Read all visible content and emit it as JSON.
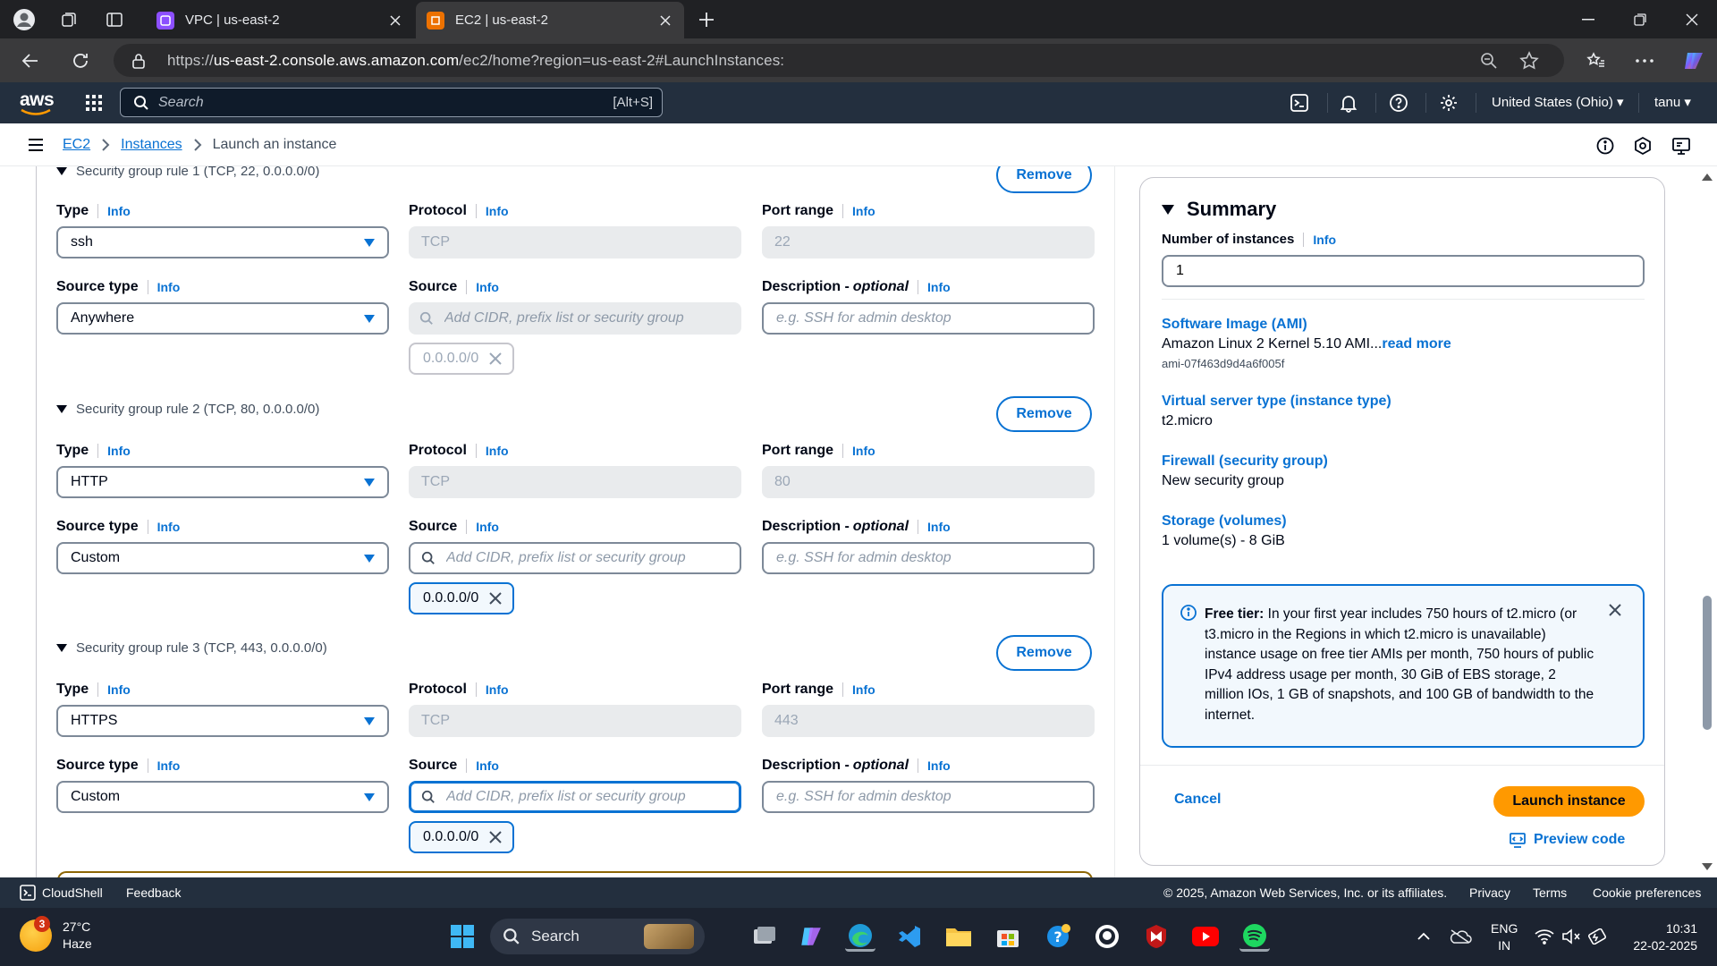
{
  "browser": {
    "tabs": [
      {
        "title": "VPC | us-east-2",
        "active": false
      },
      {
        "title": "EC2 | us-east-2",
        "active": true
      }
    ],
    "url_prefix": "https://",
    "url_host": "us-east-2.console.aws.amazon.com",
    "url_path": "/ec2/home?region=us-east-2#LaunchInstances:"
  },
  "awsnav": {
    "logo": "aws",
    "search_placeholder": "Search",
    "search_shortcut": "[Alt+S]",
    "region": "United States (Ohio) ▾",
    "user": "tanu ▾"
  },
  "breadcrumb": {
    "items": [
      "EC2",
      "Instances"
    ],
    "current": "Launch an instance"
  },
  "rules": [
    {
      "title": "Security group rule 1 (TCP, 22, 0.0.0.0/0)",
      "remove": "Remove",
      "type_label": "Type",
      "type_value": "ssh",
      "protocol_label": "Protocol",
      "protocol_value": "TCP",
      "port_label": "Port range",
      "port_value": "22",
      "source_type_label": "Source type",
      "source_type_value": "Anywhere",
      "source_label": "Source",
      "source_placeholder": "Add CIDR, prefix list or security group",
      "desc_label": "Description - ",
      "desc_optional": "optional",
      "desc_placeholder": "e.g. SSH for admin desktop",
      "token": "0.0.0.0/0",
      "source_disabled": true
    },
    {
      "title": "Security group rule 2 (TCP, 80, 0.0.0.0/0)",
      "remove": "Remove",
      "type_label": "Type",
      "type_value": "HTTP",
      "protocol_label": "Protocol",
      "protocol_value": "TCP",
      "port_label": "Port range",
      "port_value": "80",
      "source_type_label": "Source type",
      "source_type_value": "Custom",
      "source_label": "Source",
      "source_placeholder": "Add CIDR, prefix list or security group",
      "desc_label": "Description - ",
      "desc_optional": "optional",
      "desc_placeholder": "e.g. SSH for admin desktop",
      "token": "0.0.0.0/0",
      "source_disabled": false
    },
    {
      "title": "Security group rule 3 (TCP, 443, 0.0.0.0/0)",
      "remove": "Remove",
      "type_label": "Type",
      "type_value": "HTTPS",
      "protocol_label": "Protocol",
      "protocol_value": "TCP",
      "port_label": "Port range",
      "port_value": "443",
      "source_type_label": "Source type",
      "source_type_value": "Custom",
      "source_label": "Source",
      "source_placeholder": "Add CIDR, prefix list or security group",
      "desc_label": "Description - ",
      "desc_optional": "optional",
      "desc_placeholder": "e.g. SSH for admin desktop",
      "token": "0.0.0.0/0",
      "source_disabled": false
    }
  ],
  "info_label": "Info",
  "summary": {
    "heading": "Summary",
    "num_instances_label": "Number of instances",
    "num_instances_value": "1",
    "ami_label": "Software Image (AMI)",
    "ami_value": "Amazon Linux 2 Kernel 5.10 AMI...",
    "ami_read_more": "read more",
    "ami_id": "ami-07f463d9d4a6f005f",
    "instance_type_label": "Virtual server type (instance type)",
    "instance_type_value": "t2.micro",
    "firewall_label": "Firewall (security group)",
    "firewall_value": "New security group",
    "storage_label": "Storage (volumes)",
    "storage_value": "1 volume(s) - 8 GiB",
    "free_tier_bold": "Free tier:",
    "free_tier_text": " In your first year includes 750 hours of t2.micro (or t3.micro in the Regions in which t2.micro is unavailable) instance usage on free tier AMIs per month, 750 hours of public IPv4 address usage per month, 30 GiB of EBS storage, 2 million IOs, 1 GB of snapshots, and 100 GB of bandwidth to the internet.",
    "cancel": "Cancel",
    "launch": "Launch instance",
    "preview": "Preview code"
  },
  "footer": {
    "cloudshell": "CloudShell",
    "feedback": "Feedback",
    "copyright": "© 2025, Amazon Web Services, Inc. or its affiliates.",
    "privacy": "Privacy",
    "terms": "Terms",
    "cookies": "Cookie preferences"
  },
  "taskbar": {
    "weather_badge": "3",
    "temp": "27°C",
    "condition": "Haze",
    "search": "Search",
    "lang1": "ENG",
    "lang2": "IN",
    "time": "10:31",
    "date": "22-02-2025"
  },
  "colors": {
    "aws_nav": "#232f3e",
    "link_blue": "#0972d3",
    "launch_orange": "#ff9900"
  }
}
